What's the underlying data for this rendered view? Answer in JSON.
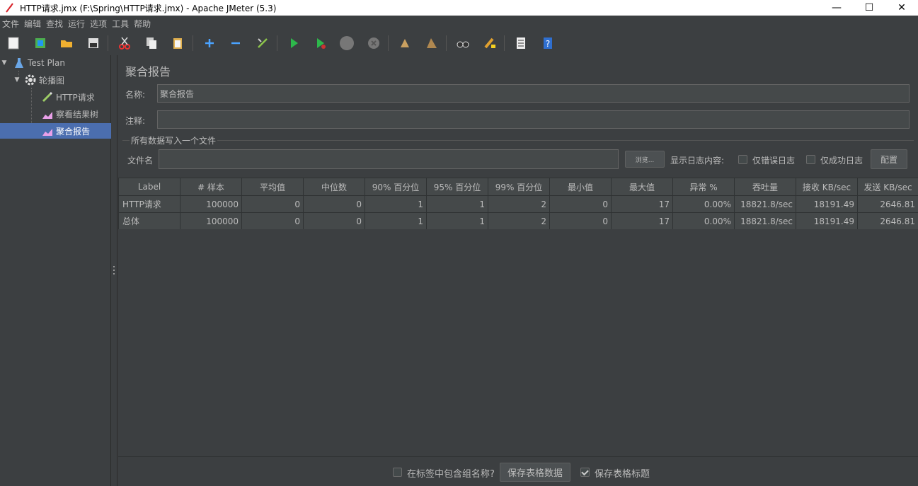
{
  "window": {
    "title": "HTTP请求.jmx (F:\\Spring\\HTTP请求.jmx) - Apache JMeter (5.3)",
    "minimize": "—",
    "maximize": "☐",
    "close": "✕"
  },
  "menu": [
    "文件",
    "编辑",
    "查找",
    "运行",
    "选项",
    "工具",
    "帮助"
  ],
  "toolbar_icons": [
    "new-icon",
    "templates-icon",
    "open-icon",
    "save-icon",
    "cut-icon",
    "copy-icon",
    "paste-icon",
    "expand-icon",
    "collapse-icon",
    "toggle-icon",
    "start-icon",
    "start-no-pause-icon",
    "stop-icon",
    "shutdown-icon",
    "clear-icon",
    "clear-all-icon",
    "search-icon",
    "reset-search-icon",
    "function-helper-icon",
    "help-icon"
  ],
  "tree": {
    "items": [
      {
        "label": "Test Plan",
        "icon": "flask-icon"
      },
      {
        "label": "轮播图",
        "icon": "gear-icon"
      },
      {
        "label": "HTTP请求",
        "icon": "pipette-icon"
      },
      {
        "label": "察看结果树",
        "icon": "graph-icon"
      },
      {
        "label": "聚合报告",
        "icon": "graph-icon",
        "selected": true
      }
    ]
  },
  "panel": {
    "title": "聚合报告",
    "name_label": "名称:",
    "name_value": "聚合报告",
    "comment_label": "注释:",
    "comment_value": "",
    "file_group_title": "所有数据写入一个文件",
    "filename_label": "文件名",
    "filename_value": "",
    "browse_button": "浏览...",
    "log_content_label": "显示日志内容:",
    "errors_only_label": "仅错误日志",
    "success_only_label": "仅成功日志",
    "configure_button": "配置"
  },
  "table": {
    "headers": [
      "Label",
      "# 样本",
      "平均值",
      "中位数",
      "90% 百分位",
      "95% 百分位",
      "99% 百分位",
      "最小值",
      "最大值",
      "异常 %",
      "吞吐量",
      "接收 KB/sec",
      "发送 KB/sec"
    ],
    "rows": [
      [
        "HTTP请求",
        "100000",
        "0",
        "0",
        "1",
        "1",
        "2",
        "0",
        "17",
        "0.00%",
        "18821.8/sec",
        "18191.49",
        "2646.81"
      ],
      [
        "总体",
        "100000",
        "0",
        "0",
        "1",
        "1",
        "2",
        "0",
        "17",
        "0.00%",
        "18821.8/sec",
        "18191.49",
        "2646.81"
      ]
    ]
  },
  "footer": {
    "include_group_label": "在标签中包含组名称?",
    "include_group_checked": false,
    "save_table_button": "保存表格数据",
    "save_header_label": "保存表格标题",
    "save_header_checked": true
  },
  "colors": {
    "background": "#3c3f41",
    "selection": "#4b6eaf",
    "text": "#bbbbbb"
  }
}
